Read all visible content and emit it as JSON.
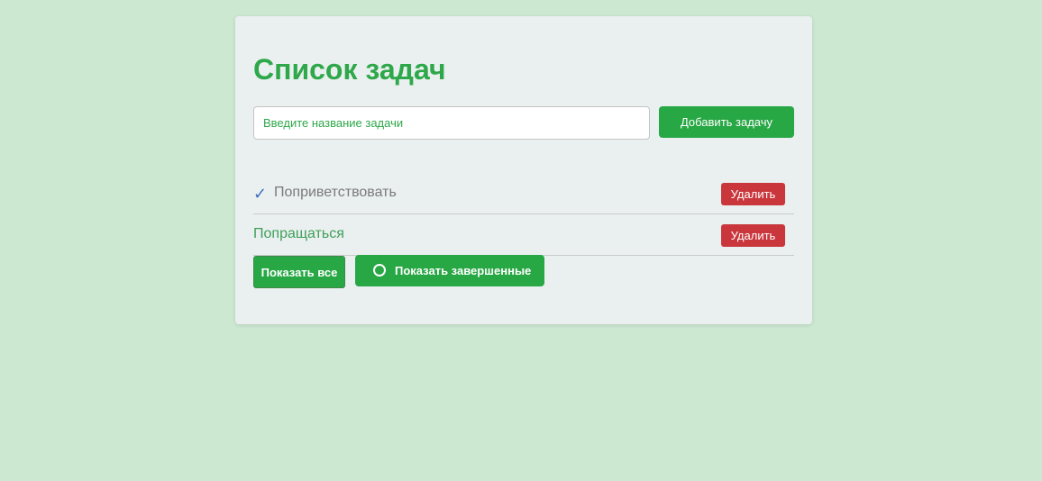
{
  "header": {
    "title": "Список задач"
  },
  "add_task": {
    "placeholder": "Введите название задачи",
    "value": "",
    "button_label": "Добавить задачу"
  },
  "tasks": [
    {
      "label": "Поприветствовать",
      "completed": true,
      "delete_label": "Удалить"
    },
    {
      "label": "Попращаться",
      "completed": false,
      "delete_label": "Удалить"
    }
  ],
  "icons": {
    "check": "✓",
    "circle": "circle-icon"
  },
  "filters": {
    "all_label": "Показать все",
    "completed_label": "Показать завершенные"
  },
  "colors": {
    "background": "#cce8d1",
    "card": "#eaf0ef",
    "accent": "#28a745",
    "title": "#2ea84a",
    "danger": "#c9363c",
    "check": "#3f6fc2"
  }
}
